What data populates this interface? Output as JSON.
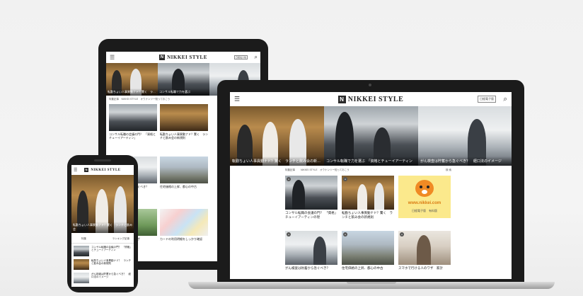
{
  "brand": {
    "name": "NIKKEI STYLE",
    "mark": "N"
  },
  "header": {
    "badge": "日経電子版",
    "menu_icon": "menu-icon",
    "search_icon": "search-icon"
  },
  "laptop": {
    "hero": [
      {
        "caption": "転勤ちょい人事異動ナド？驚く　ランチと飲み会の新規則"
      },
      {
        "caption": "コンサル転職で力を選ぶ　「資格とチューイアーティン"
      },
      {
        "caption": "がん検査は貯蓄から急ぐべき？　経口法のイメージ"
      }
    ],
    "filter_bar": {
      "left": "特集記事",
      "middle": "NIKKEI STYLE　オウナンツー知っておこう",
      "right": "検 索"
    },
    "grid": [
      {
        "title": "コンサル転職の会議の門？　「資格」チューイアーティンの現"
      },
      {
        "title": "転勤ちょい人事異動ナド？驚く　ランチと飲み会の新規則"
      },
      {
        "title": "日経電子版　有料版",
        "url": "www.nikkei.com"
      },
      {
        "title": "がん検査は貯蓄から急ぐべき？"
      },
      {
        "title": "住宅価格の上昇、都心の中古"
      },
      {
        "title": "スマホで行ける人のワザ　家計"
      }
    ]
  },
  "tablet": {
    "hero_caption": "転勤ちょい人事異動ナド？驚く　ランチと飲み会",
    "hero_caption2": "コンサル転職で力を選ぶ",
    "filter_bar": "特集記事　NIKKEI STYLE　オウナンツー知っておこう",
    "grid": [
      {
        "title": "コンサル転職の会議の門？　「資格とチューイアーティン」"
      },
      {
        "title": "転勤ちょい人事異動ナド？驚く　ランチと飲み会の新規則"
      },
      {
        "title": "がん検査は貯蓄から急ぐべき？"
      },
      {
        "title": "住宅価格の上昇、都心の中古"
      },
      {
        "title": "スマホで行ける人のワザ"
      },
      {
        "title": "カードの利用明細をしっかり確認"
      }
    ]
  },
  "phone": {
    "hero_caption": "転勤ちょい人事異動ナド？驚く　ランチと飲み会",
    "tabs": {
      "left": "特集",
      "right": "ランキング記事"
    },
    "list": [
      {
        "title": "コンサル転職の会議の門？　「資格」とチューイアーティン"
      },
      {
        "title": "転勤ちょい人事異動ナド？　ランチと飲み会の新規則"
      },
      {
        "title": "がん検査は貯蓄から急ぐべき？　経口法のイメージ"
      }
    ]
  },
  "colors": {
    "bezel": "#1b1b1b",
    "laptop_base": "#c9c9c9",
    "mascot": "#f08a24",
    "mascot_bg": "#fbe98c"
  }
}
